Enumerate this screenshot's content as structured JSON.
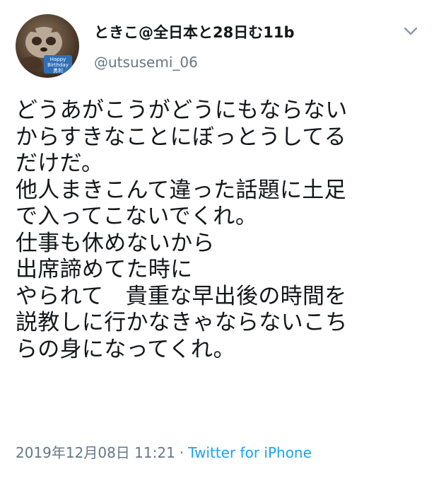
{
  "tweet": {
    "display_name": "ときこ@全日本と28日む11b",
    "handle": "@utsusemi_06",
    "avatar_badge_line1": "Happy",
    "avatar_badge_line2": "Birthday",
    "avatar_badge_line3": "勇利",
    "text": "どうあがこうがどうにもならない\nからすきなことにぼっとうしてる\nだけだ。\n他人まきこんて違った話題に土足\nで入ってこないでくれ。\n仕事も休めないから\n出席諦めてた時に\nやられて　貴重な早出後の時間を\n説教しに行かなきゃならないこち\nらの身になってくれ。",
    "timestamp": "2019年12月08日 11:21",
    "separator": "·",
    "source": "Twitter for iPhone"
  },
  "icons": {
    "menu": "chevron-down-icon"
  },
  "colors": {
    "text": "#14171a",
    "secondary": "#657786",
    "link": "#1da1f2"
  }
}
